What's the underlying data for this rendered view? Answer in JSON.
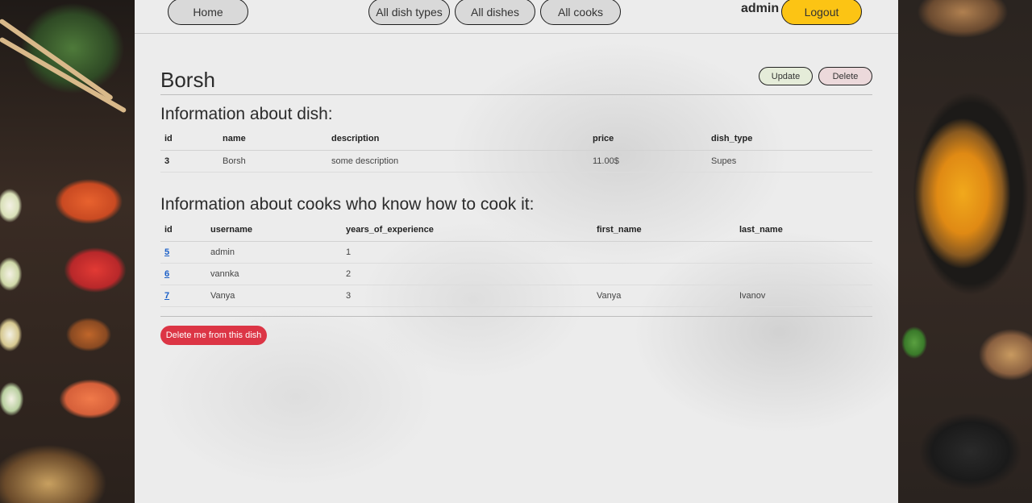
{
  "nav": {
    "home_label": "Home",
    "dish_types_label": "All dish types",
    "dishes_label": "All dishes",
    "cooks_label": "All cooks",
    "username": "admin",
    "logout_label": "Logout"
  },
  "dish": {
    "title": "Borsh",
    "update_label": "Update",
    "delete_label": "Delete"
  },
  "info_section": {
    "heading": "Information about dish:",
    "columns": [
      "id",
      "name",
      "description",
      "price",
      "dish_type"
    ],
    "row": [
      "3",
      "Borsh",
      "some description",
      "11.00$",
      "Supes"
    ]
  },
  "cooks_section": {
    "heading": "Information about cooks who know how to cook it:",
    "columns": [
      "id",
      "username",
      "years_of_experience",
      "first_name",
      "last_name"
    ],
    "rows": [
      [
        "5",
        "admin",
        "1",
        "",
        ""
      ],
      [
        "6",
        "vannka",
        "2",
        "",
        ""
      ],
      [
        "7",
        "Vanya",
        "3",
        "Vanya",
        "Ivanov"
      ]
    ]
  },
  "remove_label": "Delete me from this dish",
  "colors": {
    "logout_bg": "#fcc414",
    "update_bg": "#e5ecd9",
    "delete_bg": "#ecd9db",
    "danger_bg": "#dc3545",
    "link": "#1a5fc8"
  }
}
